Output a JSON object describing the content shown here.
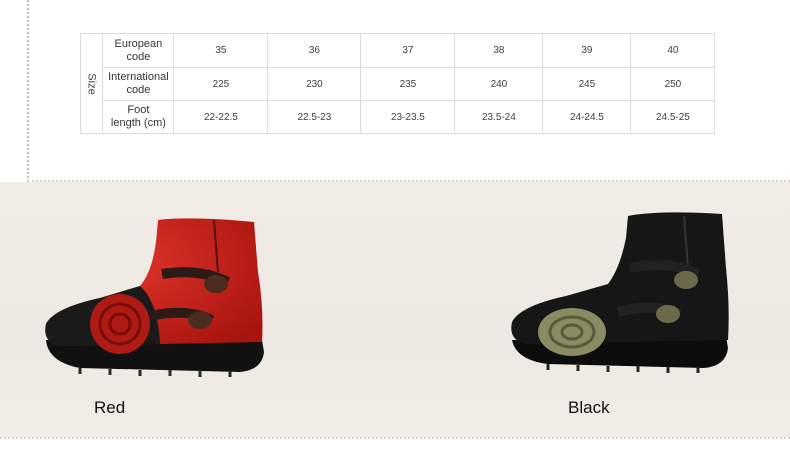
{
  "size_table": {
    "side_label": "Size",
    "rows": [
      {
        "label_line1": "European",
        "label_line2": "code",
        "values": [
          "35",
          "36",
          "37",
          "38",
          "39",
          "40"
        ]
      },
      {
        "label_line1": "International",
        "label_line2": "code",
        "values": [
          "225",
          "230",
          "235",
          "240",
          "245",
          "250"
        ]
      },
      {
        "label_line1": "Foot",
        "label_line2": "length (cm)",
        "values": [
          "22-22.5",
          "22.5-23",
          "23-23.5",
          "23.5-24",
          "24-24.5",
          "24.5-25"
        ]
      }
    ]
  },
  "products": [
    {
      "color_name": "Red",
      "hex": "#c8231f"
    },
    {
      "color_name": "Black",
      "hex": "#141414"
    }
  ]
}
